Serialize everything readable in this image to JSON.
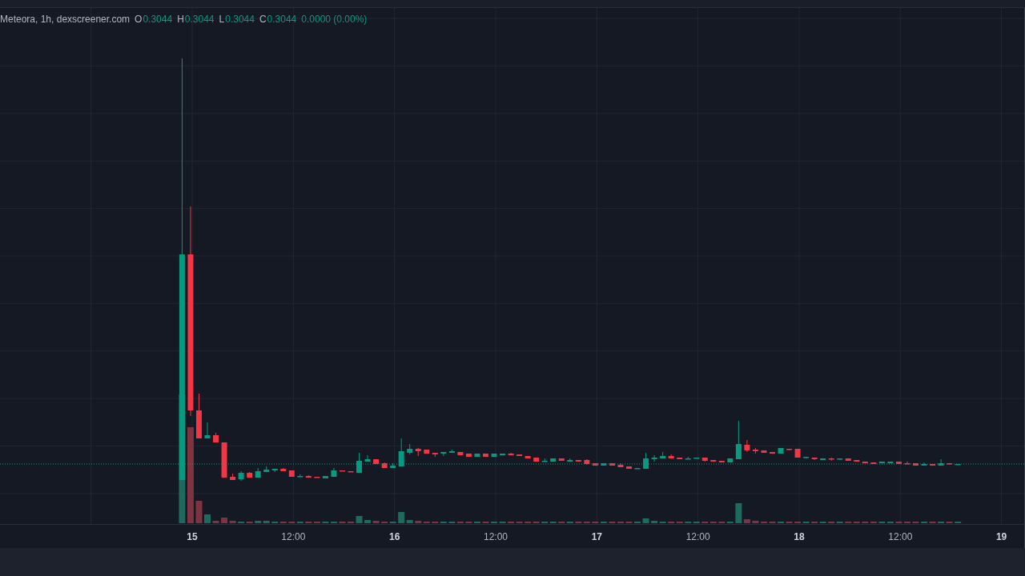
{
  "legend": {
    "title": "Meteora, 1h, dexscreener.com",
    "ohlc": [
      {
        "label": "O",
        "value": "0.3044"
      },
      {
        "label": "H",
        "value": "0.3044"
      },
      {
        "label": "L",
        "value": "0.3044"
      },
      {
        "label": "C",
        "value": "0.3044"
      }
    ],
    "change": "0.0000 (0.00%)"
  },
  "time_axis": [
    {
      "label": "15",
      "kind": "day"
    },
    {
      "label": "12:00",
      "kind": "time"
    },
    {
      "label": "16",
      "kind": "day"
    },
    {
      "label": "12:00",
      "kind": "time"
    },
    {
      "label": "17",
      "kind": "day"
    },
    {
      "label": "12:00",
      "kind": "time"
    },
    {
      "label": "18",
      "kind": "day"
    },
    {
      "label": "12:00",
      "kind": "time"
    },
    {
      "label": "19",
      "kind": "day"
    }
  ]
}
